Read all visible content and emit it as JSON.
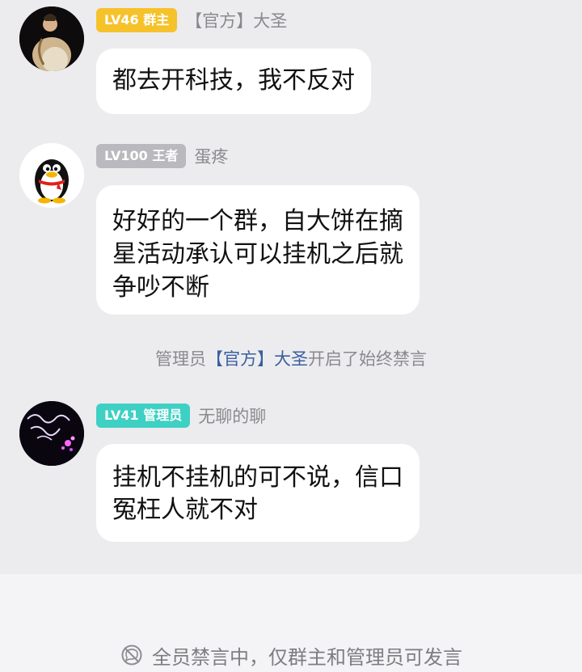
{
  "messages": [
    {
      "badge": "LV46 群主",
      "badge_color": "#f6c22b",
      "nickname": "【官方】大圣",
      "lines": [
        "都去开科技，我不反对"
      ]
    },
    {
      "badge": "LV100 王者",
      "badge_color": "#b9b9be",
      "nickname": "蛋疼",
      "lines": [
        "好好的一个群，自大饼在摘",
        "星活动承认可以挂机之后就",
        "争吵不断"
      ]
    },
    {
      "badge": "LV41 管理员",
      "badge_color": "#3fd0c4",
      "nickname": "无聊的聊",
      "lines": [
        "挂机不挂机的可不说，信口",
        "冤枉人就不对"
      ]
    }
  ],
  "system_notice": {
    "prefix": "管理员",
    "highlight": "【官方】大圣",
    "suffix": "开启了始终禁言"
  },
  "footer": {
    "mute_text": "全员禁言中，仅群主和管理员可发言",
    "icon": "mute-icon"
  }
}
